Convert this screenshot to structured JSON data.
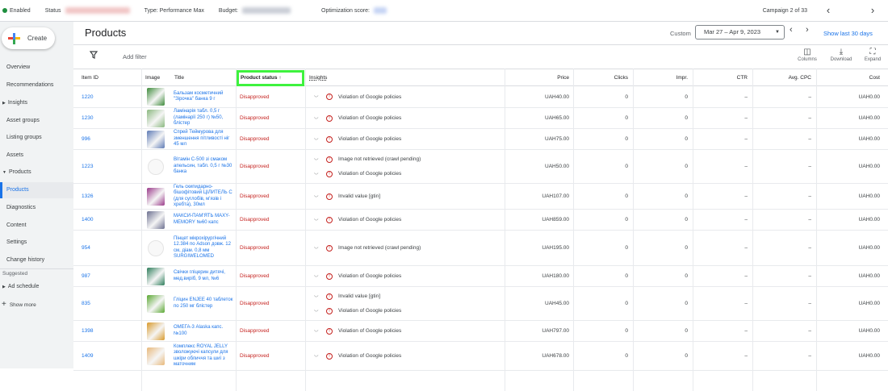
{
  "topbar": {
    "enabled": "Enabled",
    "status_label": "Status",
    "type": "Type: Performance Max",
    "budget_label": "Budget:",
    "optimization_label": "Optimization score:",
    "campaign_count": "Campaign 2 of 33"
  },
  "sidebar": {
    "create_label": "Create",
    "items": [
      "Overview",
      "Recommendations",
      "Insights",
      "Asset groups",
      "Listing groups",
      "Assets",
      "Products",
      "Products",
      "Diagnostics",
      "Content",
      "Settings",
      "Change history"
    ],
    "suggested_label": "Suggested",
    "ad_schedule": "Ad schedule",
    "show_more": "Show more"
  },
  "header": {
    "title": "Products",
    "custom_label": "Custom",
    "date_range": "Mar 27 – Apr 9, 2023",
    "last30": "Show last 30 days",
    "add_filter": "Add filter",
    "columns": "Columns",
    "download": "Download",
    "expand": "Expand"
  },
  "table": {
    "headers": {
      "item_id": "Item ID",
      "image": "Image",
      "title": "Title",
      "status": "Product status",
      "insights": "Insights",
      "price": "Price",
      "clicks": "Clicks",
      "impr": "Impr.",
      "ctr": "CTR",
      "cpc": "Avg. CPC",
      "cost": "Cost"
    },
    "rows": [
      {
        "id": "1220",
        "title": "Бальзам косметичний \"Зірочка\" банка 9 г",
        "status": "Disapproved",
        "insights": [
          "Violation of Google policies"
        ],
        "price": "UAH40.00",
        "clicks": "0",
        "impr": "0",
        "ctr": "–",
        "cpc": "–",
        "cost": "UAH0.00"
      },
      {
        "id": "1230",
        "title": "Ламінарія табл. 0,5 г (ламінарії 250 г) №50, блістер",
        "status": "Disapproved",
        "insights": [
          "Violation of Google policies"
        ],
        "price": "UAH65.00",
        "clicks": "0",
        "impr": "0",
        "ctr": "–",
        "cpc": "–",
        "cost": "UAH0.00"
      },
      {
        "id": "996",
        "title": "Спрей Теймурова для зменшення пітливості ніг 45 мл",
        "status": "Disapproved",
        "insights": [
          "Violation of Google policies"
        ],
        "price": "UAH75.00",
        "clicks": "0",
        "impr": "0",
        "ctr": "–",
        "cpc": "–",
        "cost": "UAH0.00"
      },
      {
        "id": "1223",
        "title": "Вітамін С-500 зі смаком апельсин, табл. 0,5 г №30 банка",
        "status": "Disapproved",
        "insights": [
          "Image not retrieved (crawl pending)",
          "Violation of Google policies"
        ],
        "price": "UAH50.00",
        "clicks": "0",
        "impr": "0",
        "ctr": "–",
        "cpc": "–",
        "cost": "UAH0.00"
      },
      {
        "id": "1326",
        "title": "Гель скипидарно-бішофітовий ЦІЛИТЕЛЬ С (для суглобів, м'язів і хребта), 30мл",
        "status": "Disapproved",
        "insights": [
          "Invalid value [gtin]"
        ],
        "price": "UAH107.00",
        "clicks": "0",
        "impr": "0",
        "ctr": "–",
        "cpc": "–",
        "cost": "UAH0.00"
      },
      {
        "id": "1400",
        "title": "МАКСИ-ПАМ'ЯТЬ MAXY-MEMORY №60 капс",
        "status": "Disapproved",
        "insights": [
          "Violation of Google policies"
        ],
        "price": "UAH859.00",
        "clicks": "0",
        "impr": "0",
        "ctr": "–",
        "cpc": "–",
        "cost": "UAH0.00"
      },
      {
        "id": "954",
        "title": "Пінцет мікрохірургічний 12.384 по Adson довж. 12 см, діам. 0,8 мм SURGIWELOMED",
        "status": "Disapproved",
        "insights": [
          "Image not retrieved (crawl pending)"
        ],
        "price": "UAH195.00",
        "clicks": "0",
        "impr": "0",
        "ctr": "–",
        "cpc": "–",
        "cost": "UAH0.00"
      },
      {
        "id": "987",
        "title": "Свічки гліцерин дитячі, мед.виріб, 9 мл, №6",
        "status": "Disapproved",
        "insights": [
          "Violation of Google policies"
        ],
        "price": "UAH180.00",
        "clicks": "0",
        "impr": "0",
        "ctr": "–",
        "cpc": "–",
        "cost": "UAH0.00"
      },
      {
        "id": "835",
        "title": "Гліцин ENJEE 40 таблеток по 250 мг блістер",
        "status": "Disapproved",
        "insights": [
          "Invalid value [gtin]",
          "Violation of Google policies"
        ],
        "price": "UAH45.00",
        "clicks": "0",
        "impr": "0",
        "ctr": "–",
        "cpc": "–",
        "cost": "UAH0.00"
      },
      {
        "id": "1398",
        "title": "ОМЕГА-3 Alaska капс.№100",
        "status": "Disapproved",
        "insights": [
          "Violation of Google policies"
        ],
        "price": "UAH797.00",
        "clicks": "0",
        "impr": "0",
        "ctr": "–",
        "cpc": "–",
        "cost": "UAH0.00"
      },
      {
        "id": "1409",
        "title": "Комплекс ROYAL JELLY зволожуючі капсули для шкіри обличчя та шиї з маточним",
        "status": "Disapproved",
        "insights": [
          "Violation of Google policies"
        ],
        "price": "UAH678.00",
        "clicks": "0",
        "impr": "0",
        "ctr": "–",
        "cpc": "–",
        "cost": "UAH0.00"
      }
    ]
  }
}
